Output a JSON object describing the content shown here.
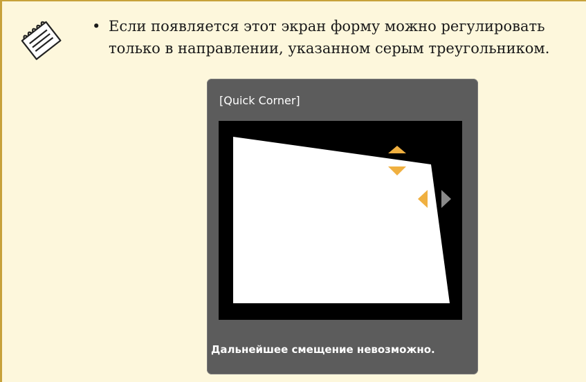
{
  "note": {
    "icon": "note-icon",
    "bullet": "•",
    "text": "Если появляется этот экран форму можно регулировать только в направлении, указанном серым треугольником."
  },
  "dialog": {
    "title": "[Quick Corner]",
    "message": "Дальнейшее смещение невозможно.",
    "arrows": {
      "up": {
        "icon": "triangle-up-icon",
        "color": "#f0b040"
      },
      "down": {
        "icon": "triangle-down-icon",
        "color": "#f0b040"
      },
      "left": {
        "icon": "triangle-left-icon",
        "color": "#f0b040"
      },
      "right": {
        "icon": "triangle-right-icon",
        "color": "#8a8a8a",
        "state": "disabled"
      }
    }
  },
  "colors": {
    "note_background": "#fdf7dc",
    "note_border": "#c7a13a",
    "dialog_background": "#5c5c5c",
    "projection_background": "#000000",
    "projection_shape": "#ffffff",
    "active_arrow": "#f0b040",
    "inactive_arrow": "#8a8a8a"
  }
}
